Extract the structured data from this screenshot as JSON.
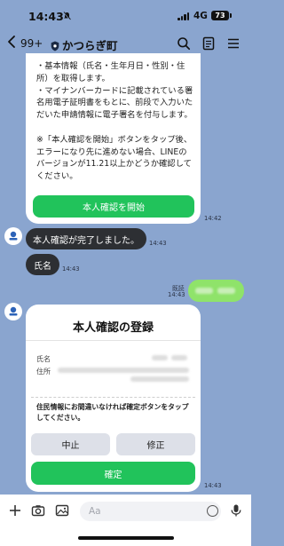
{
  "status": {
    "time": "14:43",
    "network": "4G",
    "battery": "73"
  },
  "header": {
    "unread": "99+",
    "title": "かつらぎ町"
  },
  "messages": {
    "card1_text": "・基本情報（氏名・生年月日・性別・住所）を取得します。\n・マイナンバーカードに記載されている署名用電子証明書をもとに、前段で入力いただいた申請情報に電子署名を付与します。\n\n※「本人確認を開始」ボタンをタップ後、エラーになり先に進めない場合、LINEのバージョンが11.21以上かどうか確認してください。",
    "start_button": "本人確認を開始",
    "time1": "14:42",
    "done_text": "本人確認が完了しました。",
    "time2": "14:43",
    "name_text": "氏名",
    "time3": "14:43",
    "read_label": "既読",
    "time4": "14:43",
    "registration": {
      "title": "本人確認の登録",
      "name_label": "氏名",
      "address_label": "住所",
      "notice": "住民情報にお間違いなければ確定ボタンをタップしてください。",
      "cancel": "中止",
      "edit": "修正",
      "confirm": "確定"
    },
    "time5": "14:43"
  },
  "input": {
    "placeholder": "Aa"
  },
  "colors": {
    "background": "#8aa5cf",
    "accent_green": "#21c35b",
    "my_bubble": "#8fe36a"
  }
}
